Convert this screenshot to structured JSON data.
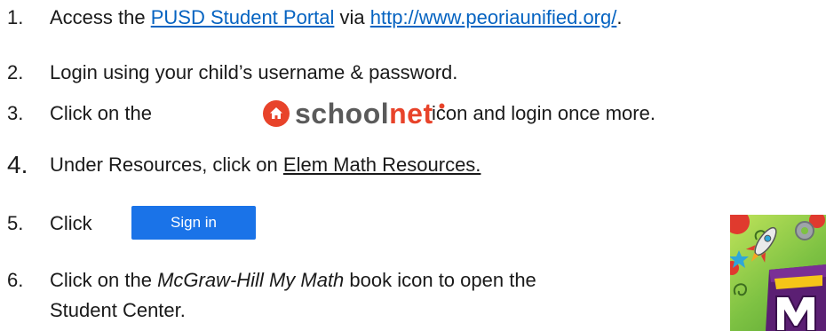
{
  "steps": [
    {
      "number": "1.",
      "prefix": "Access the ",
      "link1": "PUSD Student Portal",
      "middle": " via ",
      "link2": "http://www.peoriaunified.org/",
      "suffix": "."
    },
    {
      "number": "2.",
      "text": "Login using your child’s username & password."
    },
    {
      "number": "3.",
      "prefix": "Click on the",
      "suffix": "icon and login once more."
    },
    {
      "number": "4.",
      "prefix": "Under Resources, click on ",
      "link": "Elem Math Resources."
    },
    {
      "number": "5.",
      "prefix": "Click",
      "button_label": "Sign in"
    },
    {
      "number": "6.",
      "prefix": "Click on the ",
      "emphasis": "McGraw-Hill My Math",
      "suffix": " book icon to open the",
      "line2": "Student Center."
    }
  ],
  "schoolnet_logo": {
    "word_school": "school",
    "word_net": "net",
    "brand_color": "#e8432a"
  },
  "colors": {
    "link": "#0563c1",
    "button": "#1a73e8"
  }
}
